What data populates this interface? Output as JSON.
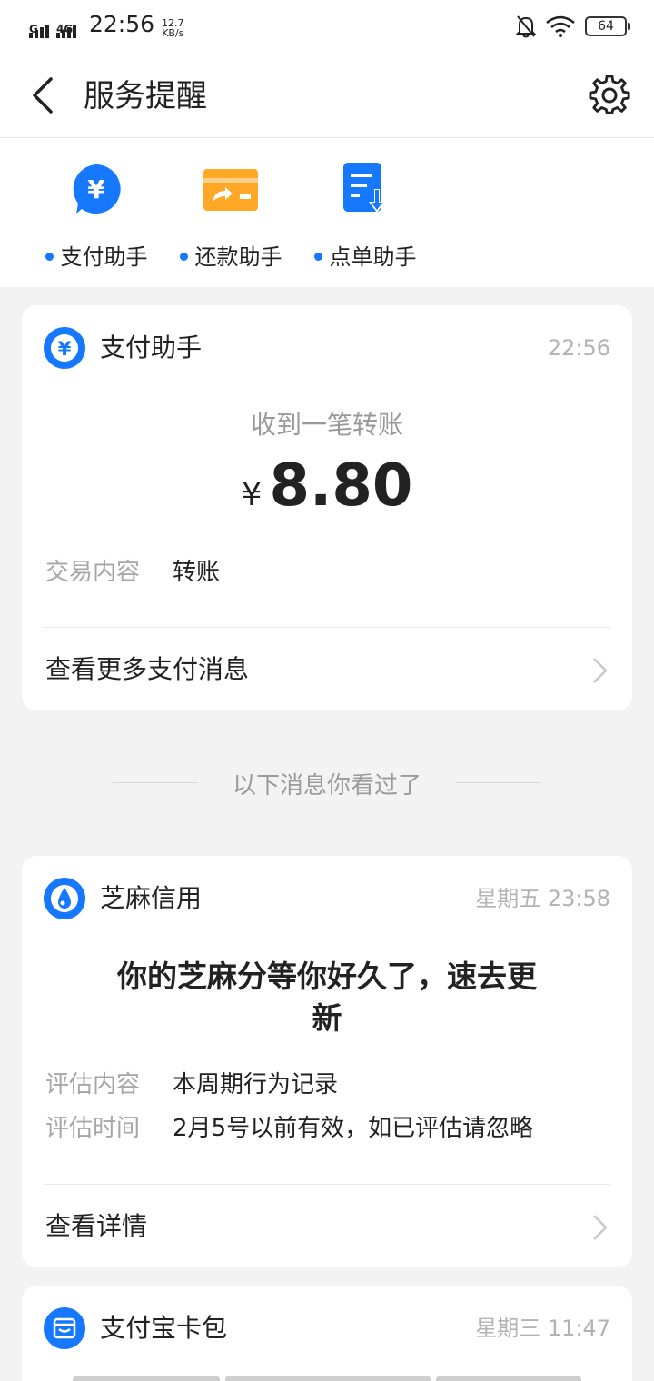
{
  "status_bar": {
    "signal1_label": "G",
    "signal2_label": "4G",
    "time": "22:56",
    "speed_value": "12.7",
    "speed_unit": "KB/s",
    "battery": "64"
  },
  "nav": {
    "title": "服务提醒"
  },
  "shortcuts": [
    {
      "label": "支付助手",
      "icon": "payment-icon"
    },
    {
      "label": "还款助手",
      "icon": "repay-card-icon"
    },
    {
      "label": "点单助手",
      "icon": "order-icon"
    }
  ],
  "card1": {
    "name": "支付助手",
    "time": "22:56",
    "subtitle": "收到一笔转账",
    "currency": "¥",
    "amount": "8.80",
    "kv_key": "交易内容",
    "kv_value": "转账",
    "more": "查看更多支付消息"
  },
  "separator": "以下消息你看过了",
  "card2": {
    "name": "芝麻信用",
    "time": "星期五 23:58",
    "headline_line1": "你的芝麻分等你好久了，速去更",
    "headline_line2": "新",
    "row1_key": "评估内容",
    "row1_value": "本周期行为记录",
    "row2_key": "评估时间",
    "row2_value": "2月5号以前有效，如已评估请忽略",
    "more": "查看详情"
  },
  "card3": {
    "name": "支付宝卡包",
    "time": "星期三 11:47"
  },
  "colors": {
    "accent": "#1677ff",
    "orange": "#ffa826",
    "muted": "#b3b3b3"
  }
}
